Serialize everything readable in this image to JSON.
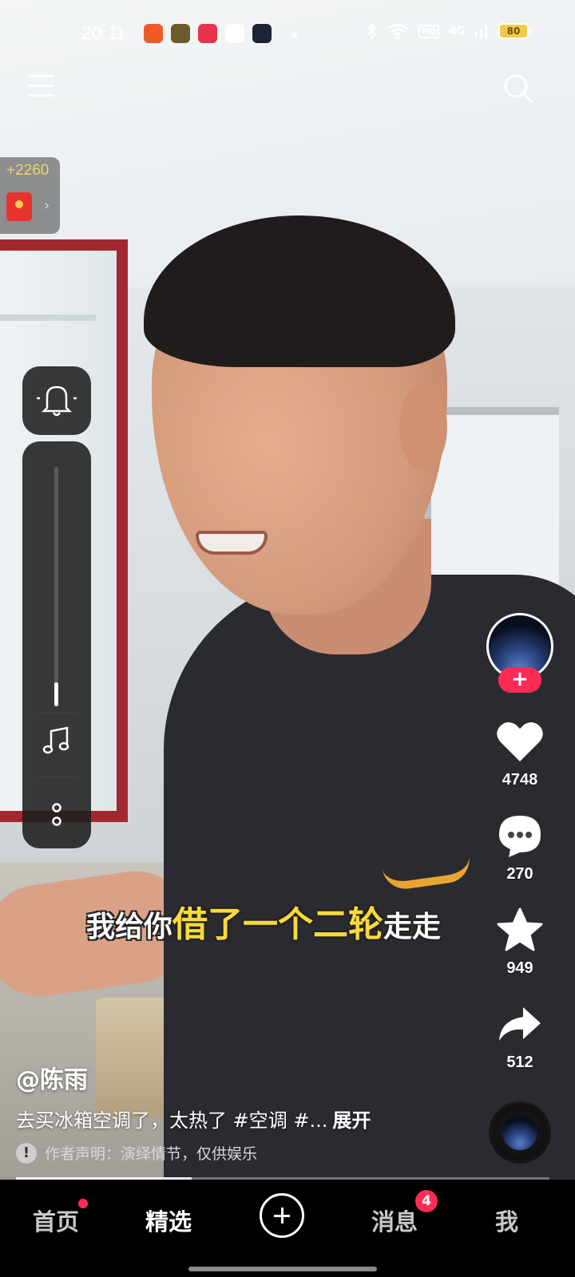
{
  "status_bar": {
    "time": "20:11",
    "network": "4G",
    "hd_label": "HD",
    "battery": "80"
  },
  "top_bar": {
    "menu_icon": "hamburger-menu-icon",
    "search_icon": "search-icon"
  },
  "reward": {
    "points": "+2260"
  },
  "volume_panel": {
    "level_fraction": 0.1
  },
  "video": {
    "subtitle_white_1": "我给你",
    "subtitle_yellow": "借了一个二轮",
    "subtitle_white_2": "走走"
  },
  "actions": {
    "likes": "4748",
    "comments": "270",
    "favorites": "949",
    "shares": "512"
  },
  "post": {
    "author": "@陈雨",
    "caption": "去买冰箱空调了，太热了 #空调 #...",
    "expand_label": "展开",
    "disclaimer": "作者声明：演绎情节，仅供娱乐",
    "progress_fraction": 0.33
  },
  "nav": {
    "home": "首页",
    "featured": "精选",
    "messages": "消息",
    "messages_badge": "4",
    "me": "我"
  },
  "colors": {
    "accent": "#fe2c55",
    "subtitle_highlight": "#f8da3a"
  }
}
